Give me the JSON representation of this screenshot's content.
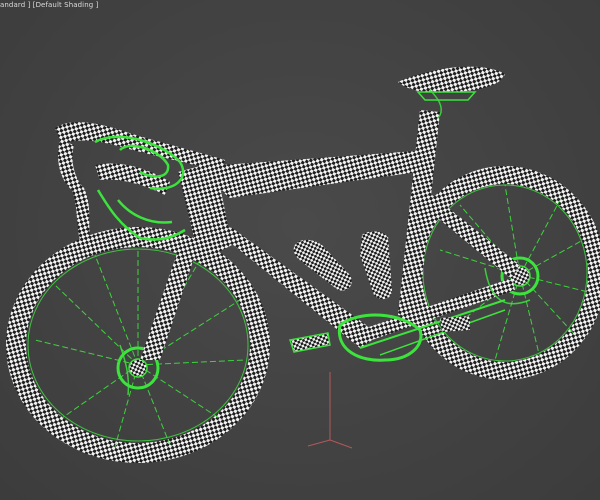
{
  "viewport": {
    "label": "andard ] [Default Shading ]",
    "shading": "Default Shading"
  },
  "scene": {
    "object": "road-bicycle-model",
    "display": "UV checker texture with selected edges",
    "colors": {
      "background": "#434343",
      "checker_light": "#f2f2f2",
      "checker_dark": "#1e1e1e",
      "wire": "#3de33d",
      "axis": "#b05a5a"
    }
  }
}
